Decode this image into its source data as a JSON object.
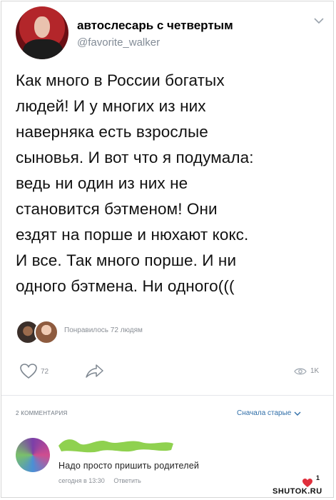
{
  "post": {
    "author_name": "автослесарь с четвертым",
    "author_handle": "@favorite_walker",
    "text": "Как много в России богатых\nлюдей! И у многих из них\nнаверняка есть взрослые\nсыновья. И вот что я подумала:\nведь ни один из них не\nстановится бэтменом! Они\nездят на порше и нюхают кокс.\nИ все. Так много порше. И ни\nодного бэтмена. Ни одного(((",
    "liked_by_text": "Понравилось 72 людям",
    "like_count": "72",
    "views_count": "1K"
  },
  "comments": {
    "count_label": "2 КОММЕНТАРИЯ",
    "sort_label": "Сначала старые",
    "items": [
      {
        "text": "Надо просто пришить родителей",
        "time": "сегодня в 13:30",
        "reply_label": "Ответить"
      }
    ]
  },
  "watermark": {
    "site": "SHUTOK.RU",
    "likes": "1"
  },
  "icons": {
    "chevron": "chevron-down-icon",
    "heart": "heart-icon",
    "share": "share-icon",
    "views": "eye-icon"
  },
  "colors": {
    "link": "#2f6ea8",
    "muted": "#8a8f96",
    "redaction": "#8fd14f",
    "watermark_heart": "#e02f3c"
  }
}
